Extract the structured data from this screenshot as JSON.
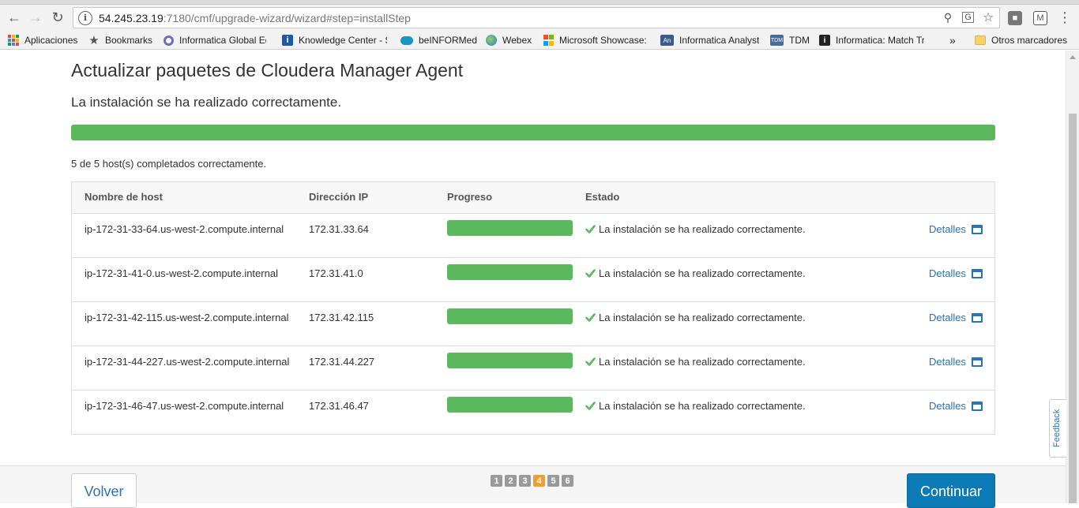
{
  "browser": {
    "url_host": "54.245.23.19",
    "url_rest": ":7180/cmf/upgrade-wizard/wizard#step=installStep",
    "bookmarks": [
      {
        "label": "Aplicaciones",
        "icon": "apps-grid-icon",
        "color": "#e04a3f"
      },
      {
        "label": "Bookmarks",
        "icon": "star-icon",
        "color": "#555555"
      },
      {
        "label": "Informatica Global Ed",
        "icon": "informatica-icon",
        "color": "#6b6bbf"
      },
      {
        "label": "Knowledge Center - S",
        "icon": "info-icon",
        "color": "#1c5aa8"
      },
      {
        "label": "beINFORMed",
        "icon": "salesforce-cloud-icon",
        "color": "#1797c0"
      },
      {
        "label": "Webex",
        "icon": "webex-globe-icon",
        "color": "#3a9a3a"
      },
      {
        "label": "Microsoft Showcase:",
        "icon": "microsoft-icon",
        "color": "#f25022"
      },
      {
        "label": "Informatica Analyst",
        "icon": "analyst-icon",
        "color": "#3b5b8c"
      },
      {
        "label": "TDM",
        "icon": "tdm-icon",
        "color": "#4a6a9a"
      },
      {
        "label": "Informatica: Match Tr",
        "icon": "informatica-i-icon",
        "color": "#222222"
      }
    ],
    "overflow_label": "»",
    "other_bookmarks": "Otros marcadores"
  },
  "page": {
    "title": "Actualizar paquetes de Cloudera Manager Agent",
    "subtitle": "La instalación se ha realizado correctamente.",
    "overall_progress": 1.0,
    "summary": "5 de 5 host(s) completados correctamente."
  },
  "table": {
    "headers": {
      "host": "Nombre de host",
      "ip": "Dirección IP",
      "progress": "Progreso",
      "status": "Estado"
    },
    "rows": [
      {
        "host": "ip-172-31-33-64.us-west-2.compute.internal",
        "ip": "172.31.33.64",
        "progress": 1.0,
        "status": "La instalación se ha realizado correctamente.",
        "details": "Detalles"
      },
      {
        "host": "ip-172-31-41-0.us-west-2.compute.internal",
        "ip": "172.31.41.0",
        "progress": 1.0,
        "status": "La instalación se ha realizado correctamente.",
        "details": "Detalles"
      },
      {
        "host": "ip-172-31-42-115.us-west-2.compute.internal",
        "ip": "172.31.42.115",
        "progress": 1.0,
        "status": "La instalación se ha realizado correctamente.",
        "details": "Detalles"
      },
      {
        "host": "ip-172-31-44-227.us-west-2.compute.internal",
        "ip": "172.31.44.227",
        "progress": 1.0,
        "status": "La instalación se ha realizado correctamente.",
        "details": "Detalles"
      },
      {
        "host": "ip-172-31-46-47.us-west-2.compute.internal",
        "ip": "172.31.46.47",
        "progress": 1.0,
        "status": "La instalación se ha realizado correctamente.",
        "details": "Detalles"
      }
    ]
  },
  "feedback": "Feedback",
  "footer": {
    "back": "Volver",
    "next": "Continuar",
    "steps": [
      "1",
      "2",
      "3",
      "4",
      "5",
      "6"
    ],
    "active_step": "4"
  },
  "colors": {
    "progress": "#5cb85c",
    "primary": "#0b7ab5",
    "link": "#2a73b8",
    "active_step": "#f0a02c"
  }
}
